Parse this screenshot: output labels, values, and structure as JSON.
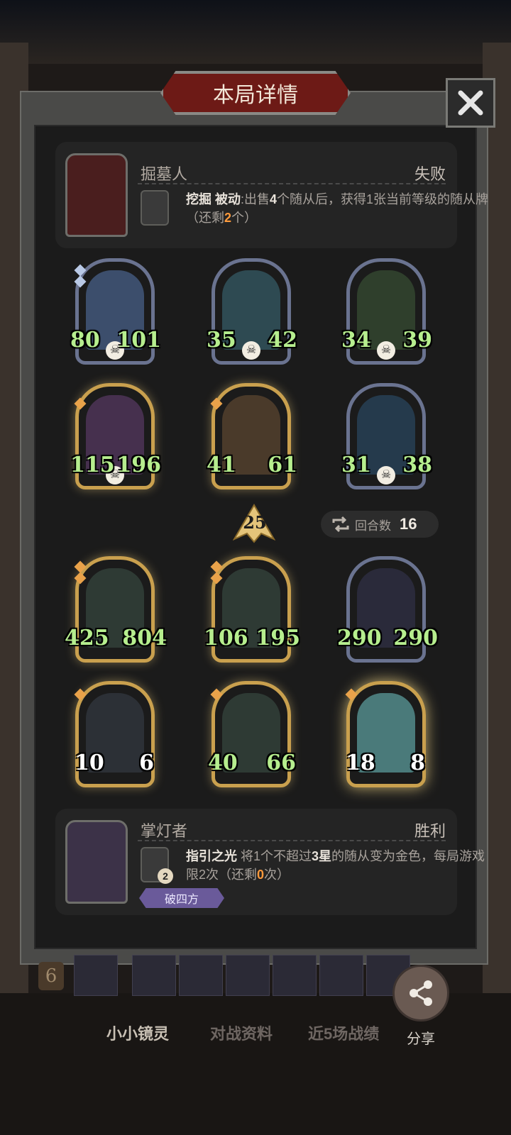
{
  "header": {
    "title": "本局详情"
  },
  "opponent": {
    "hero_name": "掘墓人",
    "result": "失败",
    "skill_name": "挖掘",
    "skill_type": "被动",
    "skill_desc_1": ":出售",
    "skill_count": "4",
    "skill_desc_2": "个随从后，获得1张当前等级的随从牌（还剩",
    "skill_remaining": "2",
    "skill_desc_3": "个）"
  },
  "opponent_board": [
    {
      "attack": "80",
      "health": "101"
    },
    {
      "attack": "35",
      "health": "42"
    },
    {
      "attack": "34",
      "health": "39"
    },
    {
      "attack": "115",
      "health": "196"
    },
    {
      "attack": "41",
      "health": "61"
    },
    {
      "attack": "31",
      "health": "38"
    }
  ],
  "tier": "25",
  "round": {
    "label": "回合数",
    "value": "16"
  },
  "player_board": [
    {
      "attack": "425",
      "health": "804"
    },
    {
      "attack": "106",
      "health": "195"
    },
    {
      "attack": "290",
      "health": "290"
    },
    {
      "attack": "10",
      "health": "6"
    },
    {
      "attack": "40",
      "health": "66"
    },
    {
      "attack": "18",
      "health": "8"
    }
  ],
  "player": {
    "hero_name": "掌灯者",
    "result": "胜利",
    "skill_name": "指引之光",
    "skill_desc_1": " 将1个不超过",
    "skill_star": "3星",
    "skill_desc_2": "的随从变为金色，每局游戏限2次（还剩",
    "skill_remaining": "0",
    "skill_desc_3": "次）",
    "skill_cost": "2",
    "tag": "破四方"
  },
  "level": "6",
  "tabs": [
    "小小镜灵",
    "对战资料",
    "近5场战绩"
  ],
  "share_label": "分享",
  "colors": {
    "stat_green": "#b6ee8e",
    "accent_orange": "#ff9a3c",
    "banner_red": "#6d1a16"
  }
}
